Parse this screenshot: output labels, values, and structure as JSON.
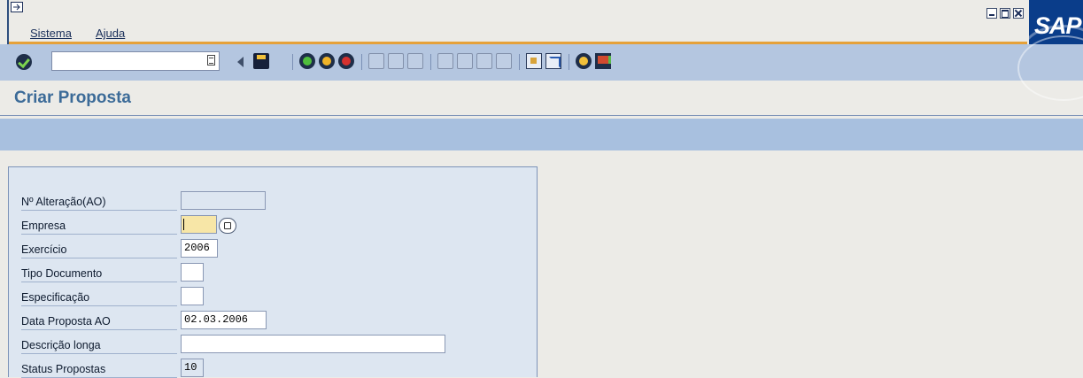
{
  "menu": {
    "items": [
      {
        "label": "Sistema"
      },
      {
        "label": "Ajuda"
      }
    ]
  },
  "brand": {
    "logo": "SAP"
  },
  "toolbar": {
    "command_value": ""
  },
  "page": {
    "title": "Criar Proposta"
  },
  "form": {
    "fields": [
      {
        "label": "Nº Alteração(AO)",
        "value": ""
      },
      {
        "label": "Empresa",
        "value": ""
      },
      {
        "label": "Exercício",
        "value": "2006"
      },
      {
        "label": "Tipo Documento",
        "value": ""
      },
      {
        "label": "Especificação",
        "value": ""
      },
      {
        "label": "Data Proposta AO",
        "value": "02.03.2006"
      },
      {
        "label": "Descrição longa",
        "value": ""
      },
      {
        "label": "Status Propostas",
        "value": "10"
      }
    ]
  },
  "colors": {
    "accent_orange": "#e5a13a",
    "toolbar_blue": "#b4c6e0",
    "title_blue": "#3c6b98",
    "required_field": "#f7e6a7"
  }
}
